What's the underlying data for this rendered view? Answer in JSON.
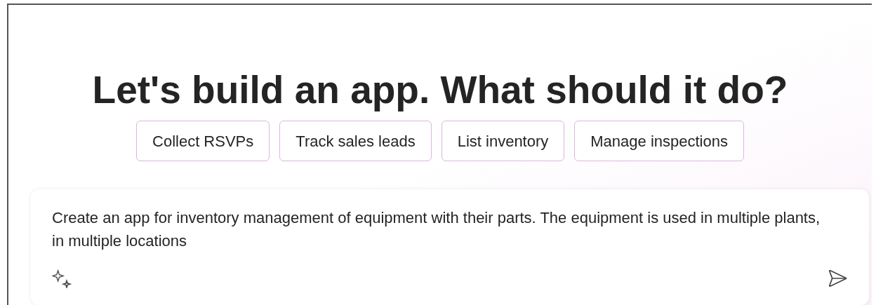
{
  "heading": "Let's build an app. What should it do?",
  "suggestions": [
    "Collect RSVPs",
    "Track sales leads",
    "List inventory",
    "Manage inspections"
  ],
  "prompt": {
    "value": "Create an app for inventory management of equipment with their parts. The equipment is used in multiple plants, in multiple locations"
  }
}
